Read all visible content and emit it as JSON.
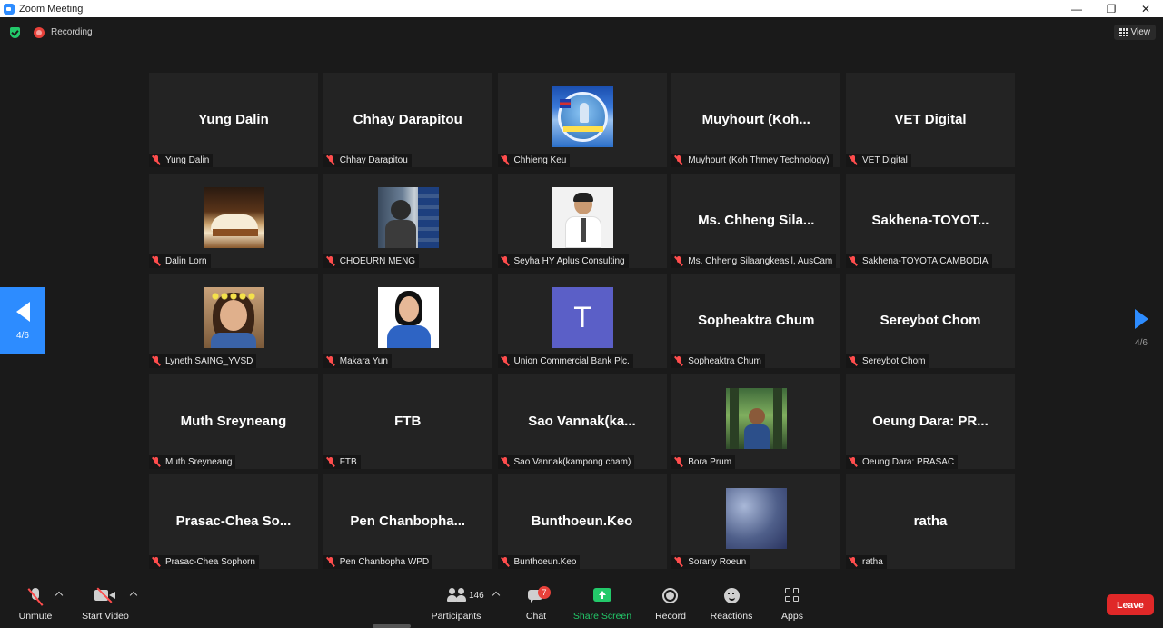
{
  "window": {
    "title": "Zoom Meeting",
    "controls": [
      "—",
      "❐",
      "✕"
    ]
  },
  "topbar": {
    "recording_label": "Recording",
    "view_label": "View"
  },
  "nav": {
    "left_page": "4/6",
    "right_page": "4/6"
  },
  "tiles": [
    {
      "display": "Yung Dalin",
      "label": "Yung Dalin"
    },
    {
      "display": "Chhay Darapitou",
      "label": "Chhay Darapitou"
    },
    {
      "display": "",
      "label": "Chhieng Keu"
    },
    {
      "display": "Muyhourt (Koh...",
      "label": "Muyhourt (Koh Thmey Technology)"
    },
    {
      "display": "VET Digital",
      "label": "VET Digital"
    },
    {
      "display": "",
      "label": "Dalin Lorn"
    },
    {
      "display": "",
      "label": "CHOEURN MENG"
    },
    {
      "display": "",
      "label": "Seyha HY Aplus Consulting"
    },
    {
      "display": "Ms. Chheng Sila...",
      "label": "Ms. Chheng Silaangkeasil, AusCam"
    },
    {
      "display": "Sakhena-TOYOT...",
      "label": "Sakhena-TOYOTA CAMBODIA"
    },
    {
      "display": "",
      "label": "Lyneth SAING_YVSD"
    },
    {
      "display": "",
      "label": "Makara Yun"
    },
    {
      "display": "T",
      "label": "Union Commercial Bank Plc."
    },
    {
      "display": "Sopheaktra Chum",
      "label": "Sopheaktra Chum"
    },
    {
      "display": "Sereybot Chom",
      "label": "Sereybot Chom"
    },
    {
      "display": "Muth Sreyneang",
      "label": "Muth Sreyneang"
    },
    {
      "display": "FTB",
      "label": "FTB"
    },
    {
      "display": "Sao Vannak(ka...",
      "label": "Sao Vannak(kampong cham)"
    },
    {
      "display": "",
      "label": "Bora Prum"
    },
    {
      "display": "Oeung Dara: PR...",
      "label": "Oeung Dara: PRASAC"
    },
    {
      "display": "Prasac-Chea So...",
      "label": "Prasac-Chea Sophorn"
    },
    {
      "display": "Pen Chanbopha...",
      "label": "Pen Chanbopha WPD"
    },
    {
      "display": "Bunthoeun.Keo",
      "label": "Bunthoeun.Keo"
    },
    {
      "display": "",
      "label": "Sorany Roeun"
    },
    {
      "display": "ratha",
      "label": "ratha"
    }
  ],
  "toolbar": {
    "unmute": "Unmute",
    "start_video": "Start Video",
    "participants": "Participants",
    "participants_count": "146",
    "chat": "Chat",
    "chat_badge": "7",
    "share_screen": "Share Screen",
    "record": "Record",
    "reactions": "Reactions",
    "apps": "Apps",
    "leave": "Leave"
  },
  "colors": {
    "accent": "#2d8cff",
    "share_green": "#23c96a",
    "leave_red": "#e02828",
    "muted_red": "#ff4d4d"
  }
}
